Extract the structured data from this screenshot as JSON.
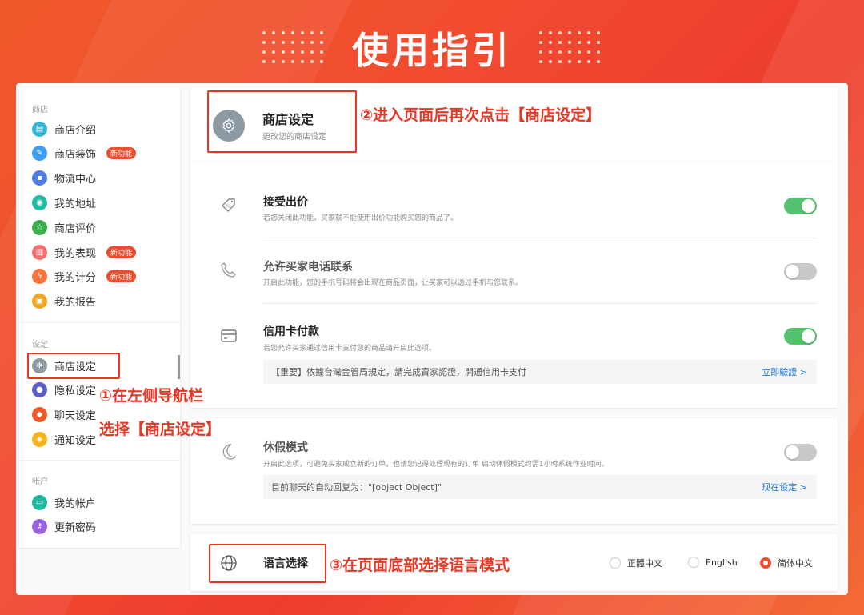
{
  "banner": {
    "title": "使用指引"
  },
  "sidebar": {
    "sections": [
      {
        "label": "商店",
        "items": [
          {
            "label": "商店介绍",
            "icon": "storefront-icon",
            "color": "#35b6d9"
          },
          {
            "label": "商店装饰",
            "icon": "brush-icon",
            "color": "#3c9df2",
            "badge": "新功能"
          },
          {
            "label": "物流中心",
            "icon": "truck-icon",
            "color": "#4f7fe2"
          },
          {
            "label": "我的地址",
            "icon": "location-pin-icon",
            "color": "#1fb8a0"
          },
          {
            "label": "商店评价",
            "icon": "star-icon",
            "color": "#3cae4f"
          },
          {
            "label": "我的表现",
            "icon": "bar-chart-icon",
            "color": "#f26f6f",
            "badge": "新功能"
          },
          {
            "label": "我的计分",
            "icon": "lightning-icon",
            "color": "#f7743c",
            "badge": "新功能"
          },
          {
            "label": "我的报告",
            "icon": "report-icon",
            "color": "#f3a51c"
          }
        ]
      },
      {
        "label": "设定",
        "items": [
          {
            "label": "商店设定",
            "icon": "gear-icon",
            "color": "#8e9aa3"
          },
          {
            "label": "隐私设定",
            "icon": "lock-icon",
            "color": "#5a5fc8"
          },
          {
            "label": "聊天设定",
            "icon": "chat-icon",
            "color": "#ef5a2d"
          },
          {
            "label": "通知设定",
            "icon": "bell-icon",
            "color": "#f6b21a"
          }
        ]
      },
      {
        "label": "帐户",
        "items": [
          {
            "label": "我的帐户",
            "icon": "id-card-icon",
            "color": "#1fb8a0"
          },
          {
            "label": "更新密码",
            "icon": "key-icon",
            "color": "#9a62e0"
          }
        ]
      }
    ]
  },
  "header": {
    "title": "商店设定",
    "subtitle": "更改您的商店设定",
    "icon": "gear-icon"
  },
  "settings": [
    {
      "title": "接受出价",
      "desc": "若您关闭此功能，买家就不能使用出价功能购买您的商品了。",
      "icon": "price-tag-icon",
      "toggle": "on"
    },
    {
      "title": "允许买家电话联系",
      "desc": "开启此功能，您的手机号码将会出现在商品页面，让买家可以透过手机与您联系。",
      "icon": "phone-icon",
      "toggle": "off"
    },
    {
      "title": "信用卡付款",
      "desc": "若您允许买家通过信用卡支付您的商品请开启此选项。",
      "icon": "credit-card-icon",
      "toggle": "on",
      "notice": {
        "text": "【重要】依據台灣金管局規定，請完成賣家認證，開通信用卡支付",
        "link": "立即驗證 >"
      }
    }
  ],
  "vacation": {
    "title": "休假模式",
    "desc": "开启此选项，可避免买家成立新的订单，也请您记得处理现有的订单 启动休假模式约需1小时系统作业时间。",
    "icon": "moon-icon",
    "toggle": "off",
    "notice": {
      "text": "目前聊天的自动回复为：\"[object Object]\"",
      "link": "现在设定 >"
    }
  },
  "language": {
    "title": "语言选择",
    "icon": "globe-icon",
    "options": [
      {
        "label": "正體中文",
        "selected": false
      },
      {
        "label": "English",
        "selected": false
      },
      {
        "label": "简体中文",
        "selected": true
      }
    ]
  },
  "annotations": {
    "a1_line1": "①在左侧导航栏",
    "a1_line2": "选择【商店设定】",
    "a2": "②进入页面后再次点击【商店设定】",
    "a3": "③在页面底部选择语言模式"
  },
  "colors": {
    "accent": "#ee4d2d",
    "annotation": "#e63624",
    "toggle_on": "#55c26f",
    "link": "#1d7bd8"
  }
}
